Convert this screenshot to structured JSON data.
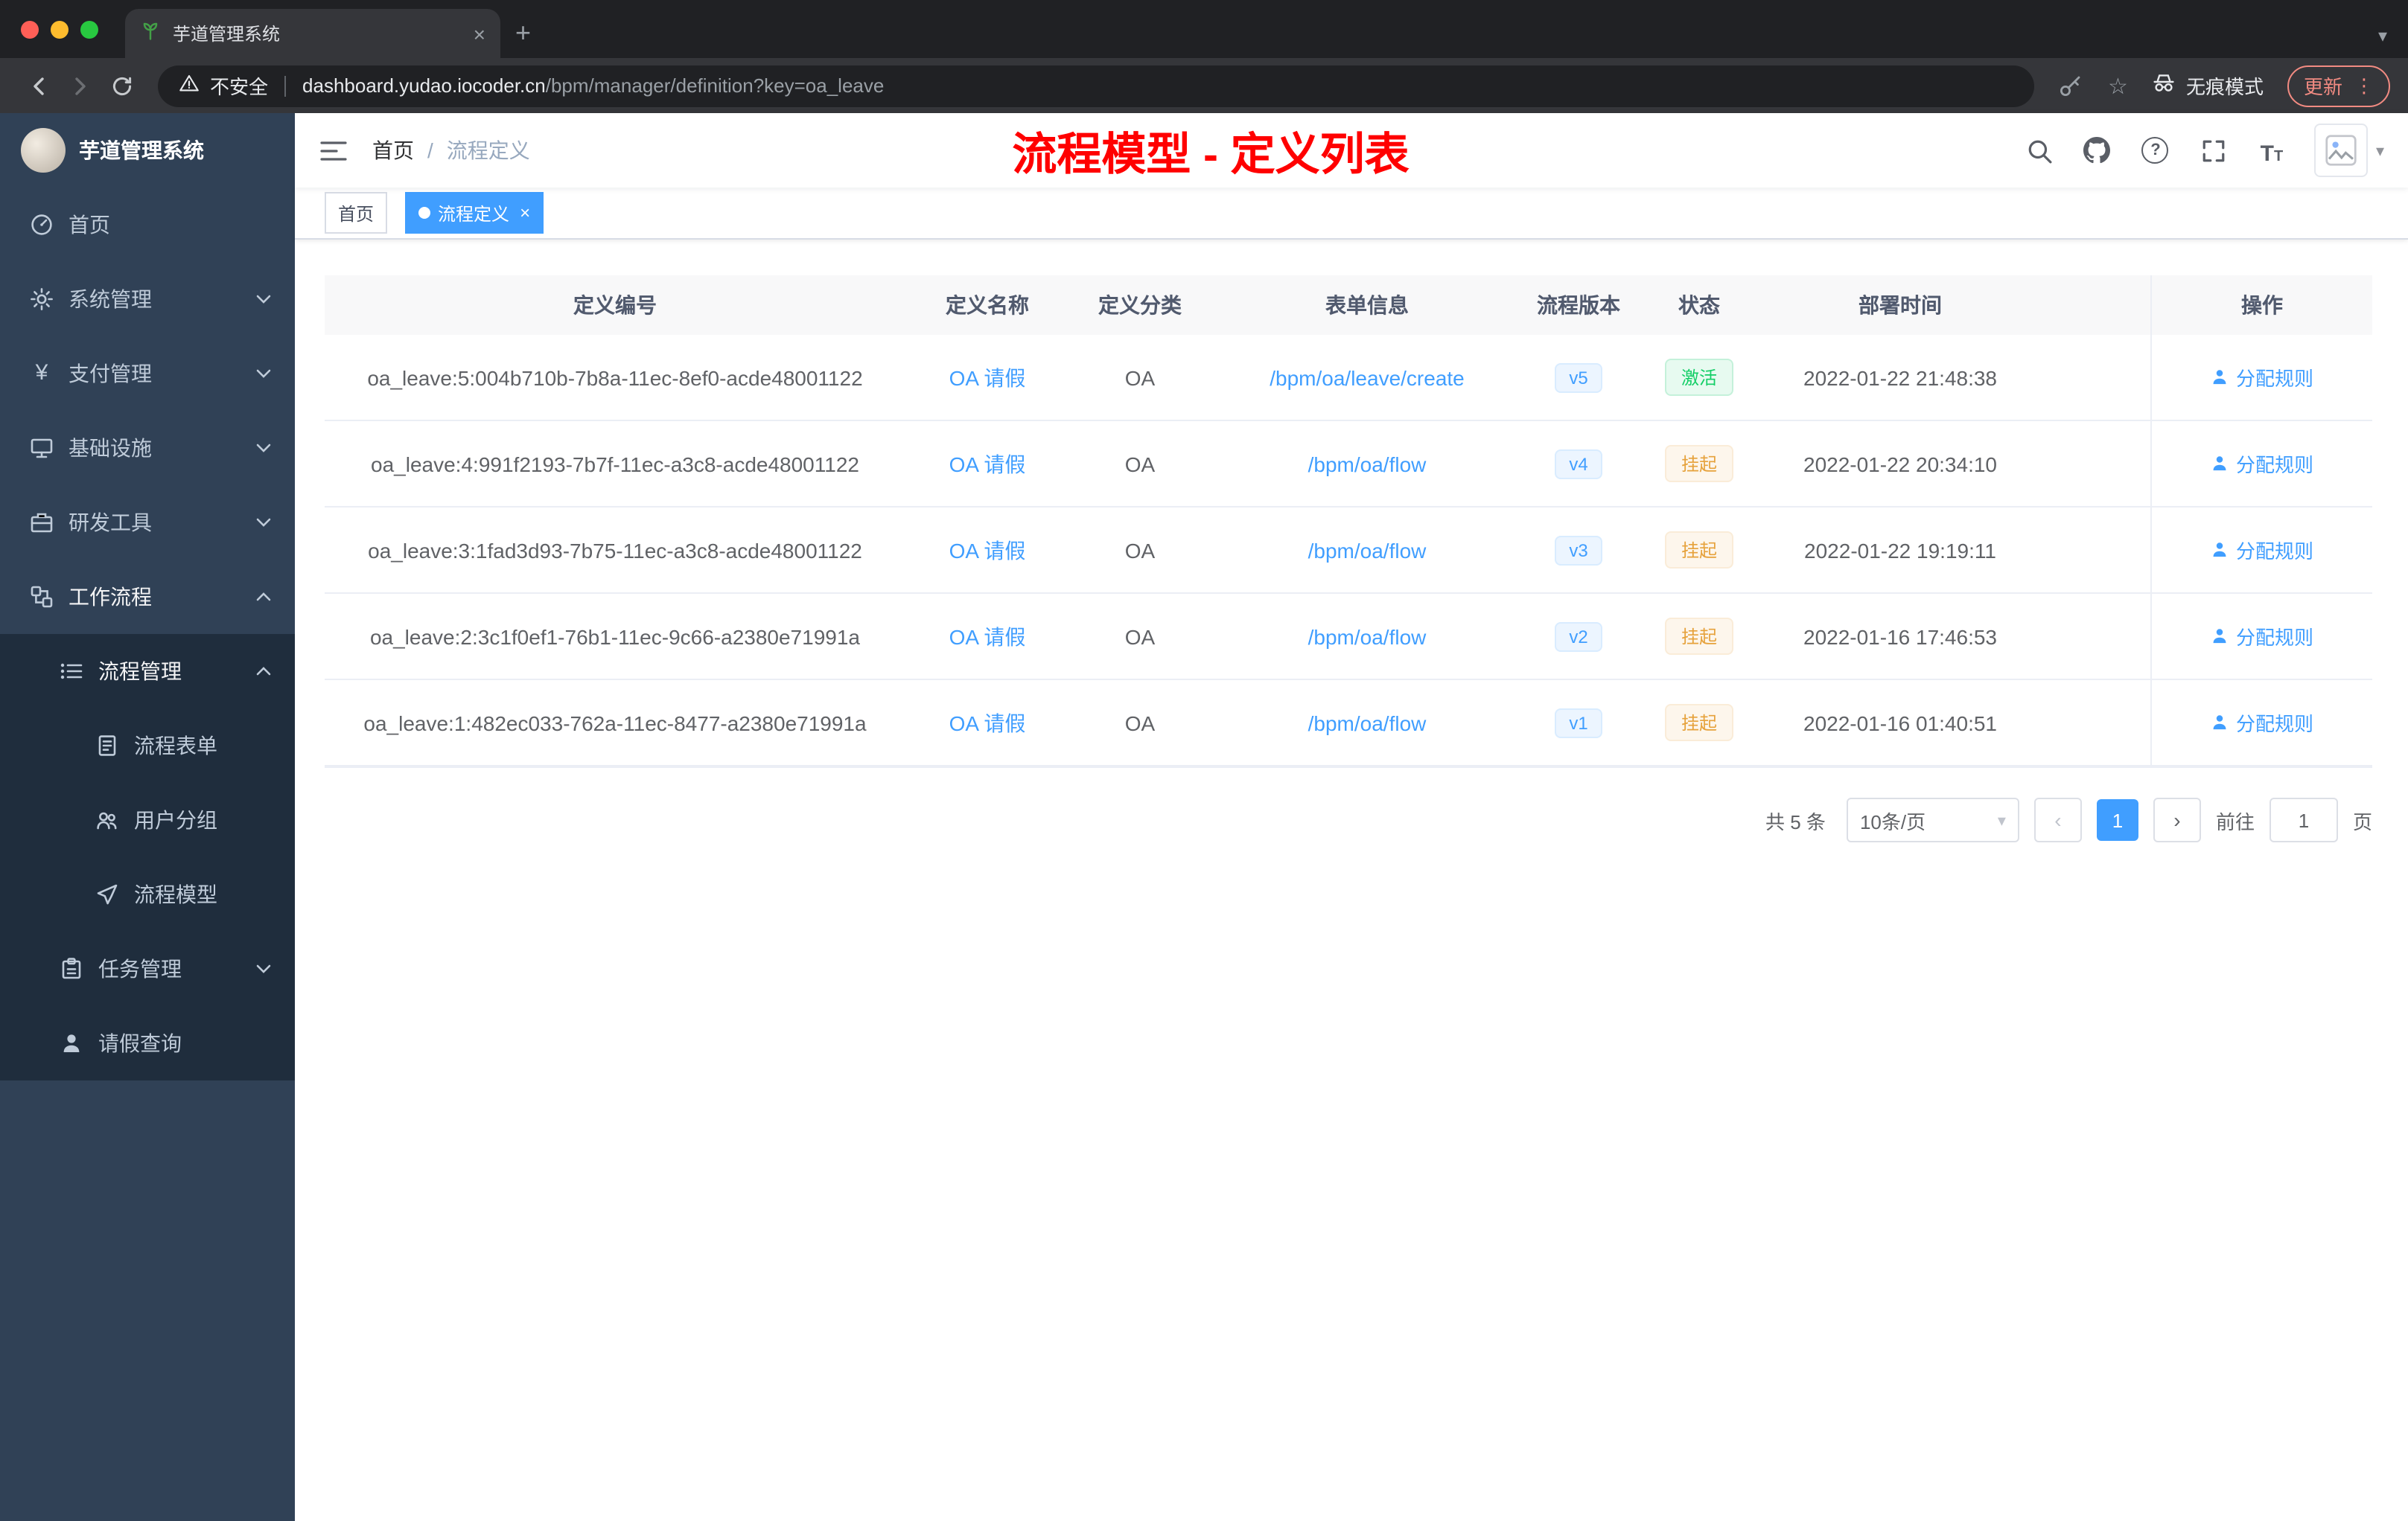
{
  "browser": {
    "tab_title": "芋道管理系统",
    "security_label": "不安全",
    "url_host": "dashboard.yudao.iocoder.cn",
    "url_path": "/bpm/manager/definition?key=oa_leave",
    "incognito_label": "无痕模式",
    "update_label": "更新"
  },
  "icons": {
    "star": "☆",
    "kebab": "⋮",
    "plus": "+",
    "close": "×",
    "caret_down": "▾",
    "question": "?",
    "yen": "¥",
    "prev": "‹",
    "next": "›",
    "font_large": "T",
    "font_small": "T"
  },
  "header": {
    "breadcrumb_home": "首页",
    "breadcrumb_separator": "/",
    "breadcrumb_current": "流程定义",
    "annotation": "流程模型 - 定义列表"
  },
  "tags": [
    {
      "label": "首页"
    },
    {
      "label": "流程定义"
    }
  ],
  "sidebar": {
    "logo_title": "芋道管理系统",
    "items": [
      {
        "label": "首页"
      },
      {
        "label": "系统管理"
      },
      {
        "label": "支付管理"
      },
      {
        "label": "基础设施"
      },
      {
        "label": "研发工具"
      },
      {
        "label": "工作流程"
      }
    ],
    "submenu": {
      "group_label": "流程管理",
      "children": [
        {
          "label": "流程表单"
        },
        {
          "label": "用户分组"
        },
        {
          "label": "流程模型"
        }
      ],
      "siblings": [
        {
          "label": "任务管理"
        },
        {
          "label": "请假查询"
        }
      ]
    }
  },
  "table": {
    "headers": {
      "id": "定义编号",
      "name": "定义名称",
      "category": "定义分类",
      "form": "表单信息",
      "version": "流程版本",
      "status": "状态",
      "time": "部署时间",
      "action": "操作"
    },
    "rows": [
      {
        "id": "oa_leave:5:004b710b-7b8a-11ec-8ef0-acde48001122",
        "name": "OA 请假",
        "category": "OA",
        "form": "/bpm/oa/leave/create",
        "version": "v5",
        "status": "激活",
        "time": "2022-01-22 21:48:38",
        "action": "分配规则"
      },
      {
        "id": "oa_leave:4:991f2193-7b7f-11ec-a3c8-acde48001122",
        "name": "OA 请假",
        "category": "OA",
        "form": "/bpm/oa/flow",
        "version": "v4",
        "status": "挂起",
        "time": "2022-01-22 20:34:10",
        "action": "分配规则"
      },
      {
        "id": "oa_leave:3:1fad3d93-7b75-11ec-a3c8-acde48001122",
        "name": "OA 请假",
        "category": "OA",
        "form": "/bpm/oa/flow",
        "version": "v3",
        "status": "挂起",
        "time": "2022-01-22 19:19:11",
        "action": "分配规则"
      },
      {
        "id": "oa_leave:2:3c1f0ef1-76b1-11ec-9c66-a2380e71991a",
        "name": "OA 请假",
        "category": "OA",
        "form": "/bpm/oa/flow",
        "version": "v2",
        "status": "挂起",
        "time": "2022-01-16 17:46:53",
        "action": "分配规则"
      },
      {
        "id": "oa_leave:1:482ec033-762a-11ec-8477-a2380e71991a",
        "name": "OA 请假",
        "category": "OA",
        "form": "/bpm/oa/flow",
        "version": "v1",
        "status": "挂起",
        "time": "2022-01-16 01:40:51",
        "action": "分配规则"
      }
    ]
  },
  "pagination": {
    "total": "共 5 条",
    "page_size": "10条/页",
    "current_page": "1",
    "goto_label": "前往",
    "goto_value": "1",
    "page_unit": "页"
  }
}
